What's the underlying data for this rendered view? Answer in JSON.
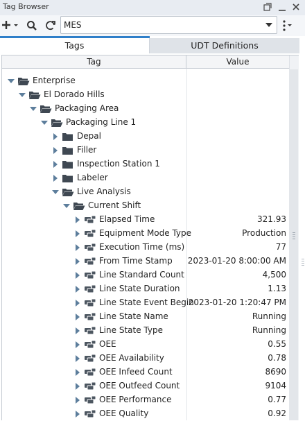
{
  "window": {
    "title": "Tag Browser"
  },
  "toolbar": {
    "search_value": "MES"
  },
  "tabs": [
    {
      "label": "Tags"
    },
    {
      "label": "UDT Definitions"
    }
  ],
  "table": {
    "columns": [
      "Tag",
      "Value"
    ]
  },
  "tree": [
    {
      "label": "Enterprise",
      "depth": 0,
      "expanded": true,
      "icon": "folder-open-icon",
      "value": ""
    },
    {
      "label": "El Dorado Hills",
      "depth": 1,
      "expanded": true,
      "icon": "folder-open-icon",
      "value": ""
    },
    {
      "label": "Packaging Area",
      "depth": 2,
      "expanded": true,
      "icon": "folder-open-icon",
      "value": ""
    },
    {
      "label": "Packaging Line 1",
      "depth": 3,
      "expanded": true,
      "icon": "folder-open-icon",
      "value": ""
    },
    {
      "label": "Depal",
      "depth": 4,
      "expanded": false,
      "icon": "folder-icon",
      "value": ""
    },
    {
      "label": "Filler",
      "depth": 4,
      "expanded": false,
      "icon": "folder-icon",
      "value": ""
    },
    {
      "label": "Inspection Station 1",
      "depth": 4,
      "expanded": false,
      "icon": "folder-icon",
      "value": ""
    },
    {
      "label": "Labeler",
      "depth": 4,
      "expanded": false,
      "icon": "folder-icon",
      "value": ""
    },
    {
      "label": "Live Analysis",
      "depth": 4,
      "expanded": true,
      "icon": "folder-open-icon",
      "value": ""
    },
    {
      "label": "Current Shift",
      "depth": 5,
      "expanded": true,
      "icon": "folder-open-icon",
      "value": ""
    },
    {
      "label": "Elapsed Time",
      "depth": 6,
      "expanded": false,
      "icon": "udt-instance-icon",
      "value": "321.93"
    },
    {
      "label": "Equipment Mode Type",
      "depth": 6,
      "expanded": false,
      "icon": "udt-instance-icon",
      "value": "Production"
    },
    {
      "label": "Execution Time (ms)",
      "depth": 6,
      "expanded": false,
      "icon": "udt-instance-icon",
      "value": "77"
    },
    {
      "label": "From Time Stamp",
      "depth": 6,
      "expanded": false,
      "icon": "udt-instance-icon",
      "value": "2023-01-20 8:00:00 AM"
    },
    {
      "label": "Line Standard Count",
      "depth": 6,
      "expanded": false,
      "icon": "udt-instance-icon",
      "value": "4,500"
    },
    {
      "label": "Line State Duration",
      "depth": 6,
      "expanded": false,
      "icon": "udt-instance-icon",
      "value": "1.13"
    },
    {
      "label": "Line State Event Begin",
      "depth": 6,
      "expanded": false,
      "icon": "udt-instance-icon",
      "value": "2023-01-20 1:20:47 PM"
    },
    {
      "label": "Line State Name",
      "depth": 6,
      "expanded": false,
      "icon": "udt-instance-icon",
      "value": "Running"
    },
    {
      "label": "Line State Type",
      "depth": 6,
      "expanded": false,
      "icon": "udt-instance-icon",
      "value": "Running"
    },
    {
      "label": "OEE",
      "depth": 6,
      "expanded": false,
      "icon": "udt-instance-icon",
      "value": "0.55"
    },
    {
      "label": "OEE Availability",
      "depth": 6,
      "expanded": false,
      "icon": "udt-instance-icon",
      "value": "0.78"
    },
    {
      "label": "OEE Infeed Count",
      "depth": 6,
      "expanded": false,
      "icon": "udt-instance-icon",
      "value": "8690"
    },
    {
      "label": "OEE Outfeed Count",
      "depth": 6,
      "expanded": false,
      "icon": "udt-instance-icon",
      "value": "9104"
    },
    {
      "label": "OEE Performance",
      "depth": 6,
      "expanded": false,
      "icon": "udt-instance-icon",
      "value": "0.77"
    },
    {
      "label": "OEE Quality",
      "depth": 6,
      "expanded": false,
      "icon": "udt-instance-icon",
      "value": "0.92"
    }
  ],
  "colors": {
    "accent": "#2f7fc9",
    "folder": "#3f4852",
    "tag_icon": "#4c5660"
  }
}
